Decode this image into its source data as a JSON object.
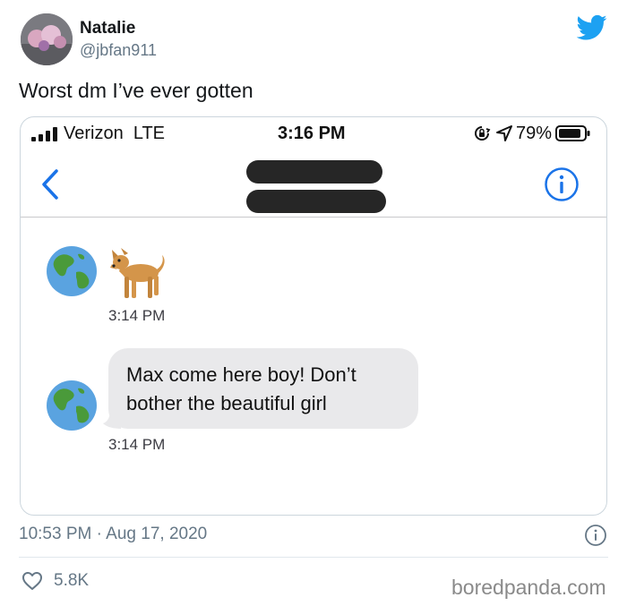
{
  "user": {
    "name": "Natalie",
    "handle": "@jbfan911"
  },
  "tweet": {
    "text": "Worst dm I’ve ever gotten",
    "timestamp": "10:53 PM · Aug 17, 2020",
    "likes": "5.8K"
  },
  "phone": {
    "status_bar": {
      "carrier": "Verizon  LTE",
      "time": "3:16 PM",
      "battery": "79%"
    },
    "messages": [
      {
        "kind": "emoji",
        "icon": "dog-icon",
        "time": "3:14 PM"
      },
      {
        "kind": "text",
        "text": "Max come here boy! Don’t bother the beautiful girl",
        "time": "3:14 PM"
      }
    ]
  },
  "watermark": "boredpanda.com",
  "colors": {
    "twitter_blue": "#1da1f2",
    "ios_blue": "#1a73e8",
    "bubble_gray": "#e9e9eb",
    "secondary_text": "#657786"
  },
  "icons": [
    "twitter-bird-icon",
    "chevron-left-icon",
    "info-icon",
    "globe-icon",
    "dog-icon",
    "heart-icon",
    "location-arrow-icon",
    "orientation-lock-icon",
    "battery-icon",
    "signal-icon"
  ]
}
